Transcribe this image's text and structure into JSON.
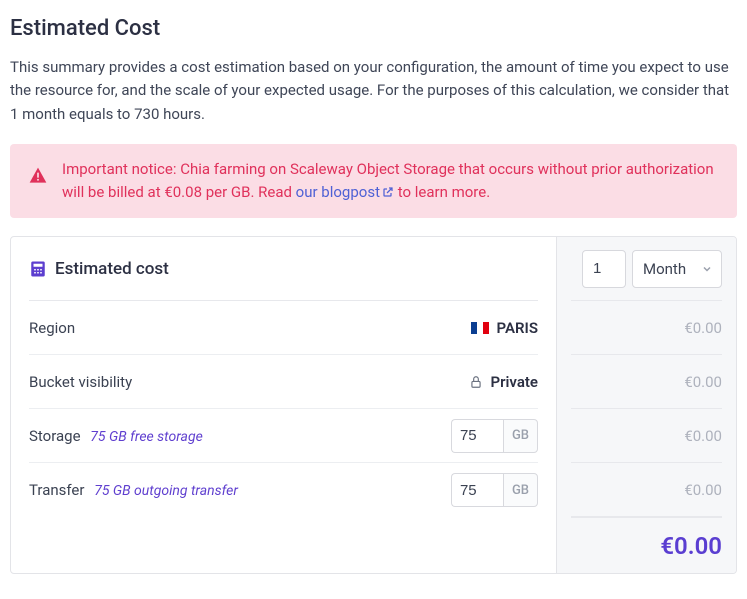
{
  "title": "Estimated Cost",
  "intro": "This summary provides a cost estimation based on your configuration, the amount of time you expect to use the resource for, and the scale of your expected usage. For the purposes of this calculation, we consider that 1 month equals to 730 hours.",
  "notice": {
    "before_link": "Important notice: Chia farming on Scaleway Object Storage that occurs without prior authorization will be billed at €0.08 per GB. Read ",
    "link_text": "our blogpost",
    "after_link": " to learn more."
  },
  "panel": {
    "header": "Estimated cost",
    "quantity": "1",
    "period": "Month",
    "rows": {
      "region": {
        "label": "Region",
        "value": "PARIS",
        "price": "€0.00"
      },
      "visibility": {
        "label": "Bucket visibility",
        "value": "Private",
        "price": "€0.00"
      },
      "storage": {
        "label": "Storage",
        "hint": "75 GB free storage",
        "value": "75",
        "unit": "GB",
        "price": "€0.00"
      },
      "transfer": {
        "label": "Transfer",
        "hint": "75 GB outgoing transfer",
        "value": "75",
        "unit": "GB",
        "price": "€0.00"
      }
    },
    "total": "€0.00"
  }
}
